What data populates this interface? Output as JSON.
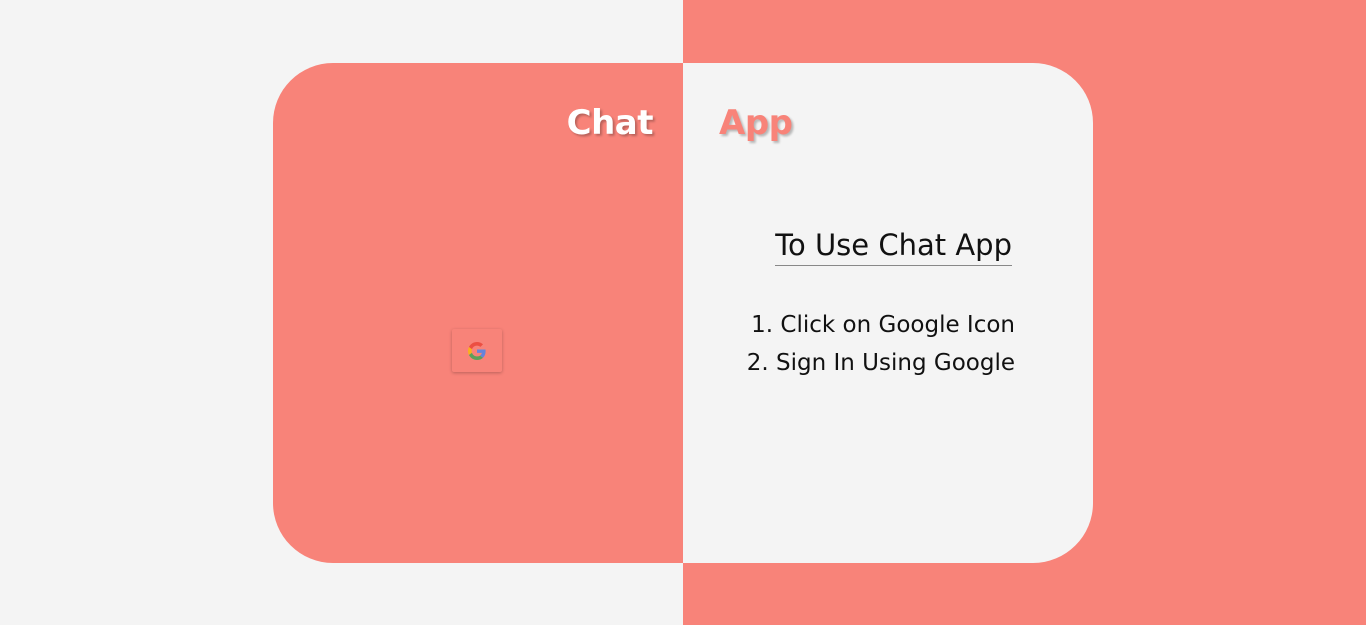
{
  "brand": {
    "title_left": "Chat",
    "title_right": "App"
  },
  "colors": {
    "accent": "#f88379",
    "light": "#f4f4f4",
    "text": "#111111"
  },
  "login": {
    "google_button_icon": "google-icon"
  },
  "instructions": {
    "heading": "To Use Chat App",
    "steps": [
      "1. Click on Google Icon",
      "2. Sign In Using Google"
    ]
  }
}
